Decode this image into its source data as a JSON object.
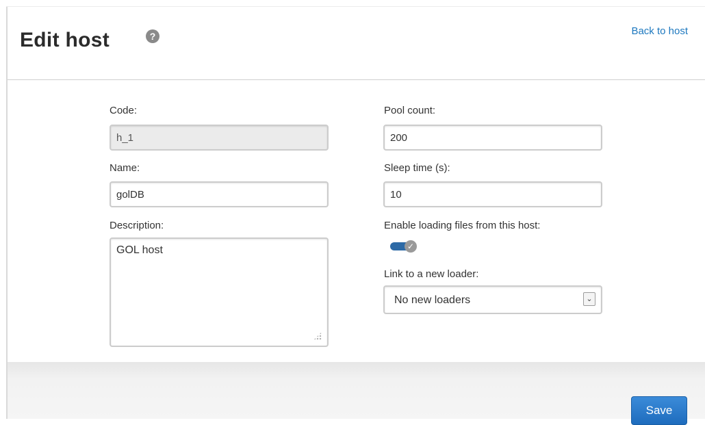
{
  "header": {
    "title": "Edit host",
    "help_icon": "question-circle-icon",
    "back_link": "Back to host"
  },
  "form": {
    "code": {
      "label": "Code:",
      "value": "h_1"
    },
    "name": {
      "label": "Name:",
      "value": "golDB"
    },
    "description": {
      "label": "Description:",
      "value": "GOL host"
    },
    "pool_count": {
      "label": "Pool count:",
      "value": "200"
    },
    "sleep_time": {
      "label": "Sleep time (s):",
      "value": "10"
    },
    "enable_loading": {
      "label": "Enable loading files from this host:",
      "checked": true,
      "accent": "#2d6aa6"
    },
    "link_loader": {
      "label": "Link to a new loader:",
      "selected": "No new loaders"
    }
  },
  "footer": {
    "save_label": "Save",
    "save_color": "#1e6cbd"
  }
}
